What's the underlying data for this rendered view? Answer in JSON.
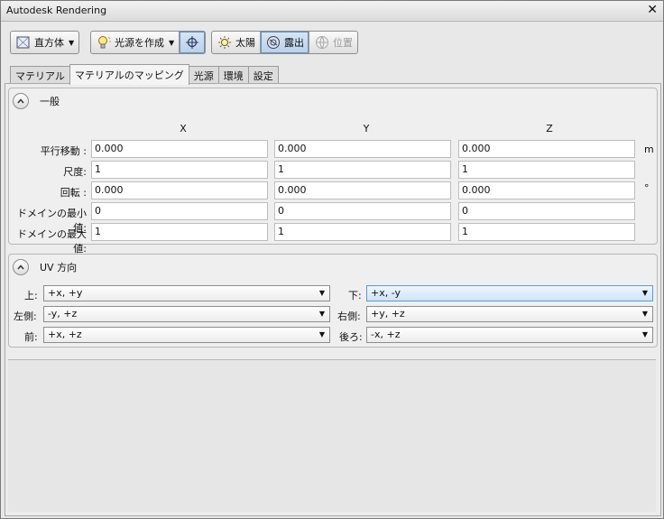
{
  "window": {
    "title": "Autodesk Rendering",
    "close_label": "✕"
  },
  "toolbar": {
    "box_label": "直方体",
    "create_light_label": "光源を作成",
    "sun_label": "太陽",
    "exposure_label": "露出",
    "location_label": "位置"
  },
  "tabs": [
    {
      "label": "マテリアル"
    },
    {
      "label": "マテリアルのマッピング"
    },
    {
      "label": "光源"
    },
    {
      "label": "環境"
    },
    {
      "label": "設定"
    }
  ],
  "general": {
    "title": "一般",
    "columns": [
      "X",
      "Y",
      "Z"
    ],
    "rows": [
      {
        "label": "平行移動 :",
        "values": [
          "0.000",
          "0.000",
          "0.000"
        ],
        "unit": "m"
      },
      {
        "label": "尺度:",
        "values": [
          "1",
          "1",
          "1"
        ],
        "unit": ""
      },
      {
        "label": "回転 :",
        "values": [
          "0.000",
          "0.000",
          "0.000"
        ],
        "unit": "°"
      },
      {
        "label": "ドメインの最小値:",
        "values": [
          "0",
          "0",
          "0"
        ],
        "unit": ""
      },
      {
        "label": "ドメインの最大値:",
        "values": [
          "1",
          "1",
          "1"
        ],
        "unit": ""
      }
    ]
  },
  "uv": {
    "title": "UV 方向",
    "top_label": "上:",
    "top_value": "+x, +y",
    "bottom_label": "下:",
    "bottom_value": "+x, -y",
    "left_label": "左側:",
    "left_value": "-y, +z",
    "right_label": "右側:",
    "right_value": "+y, +z",
    "front_label": "前:",
    "front_value": "+x, +z",
    "back_label": "後ろ:",
    "back_value": "-x, +z"
  }
}
